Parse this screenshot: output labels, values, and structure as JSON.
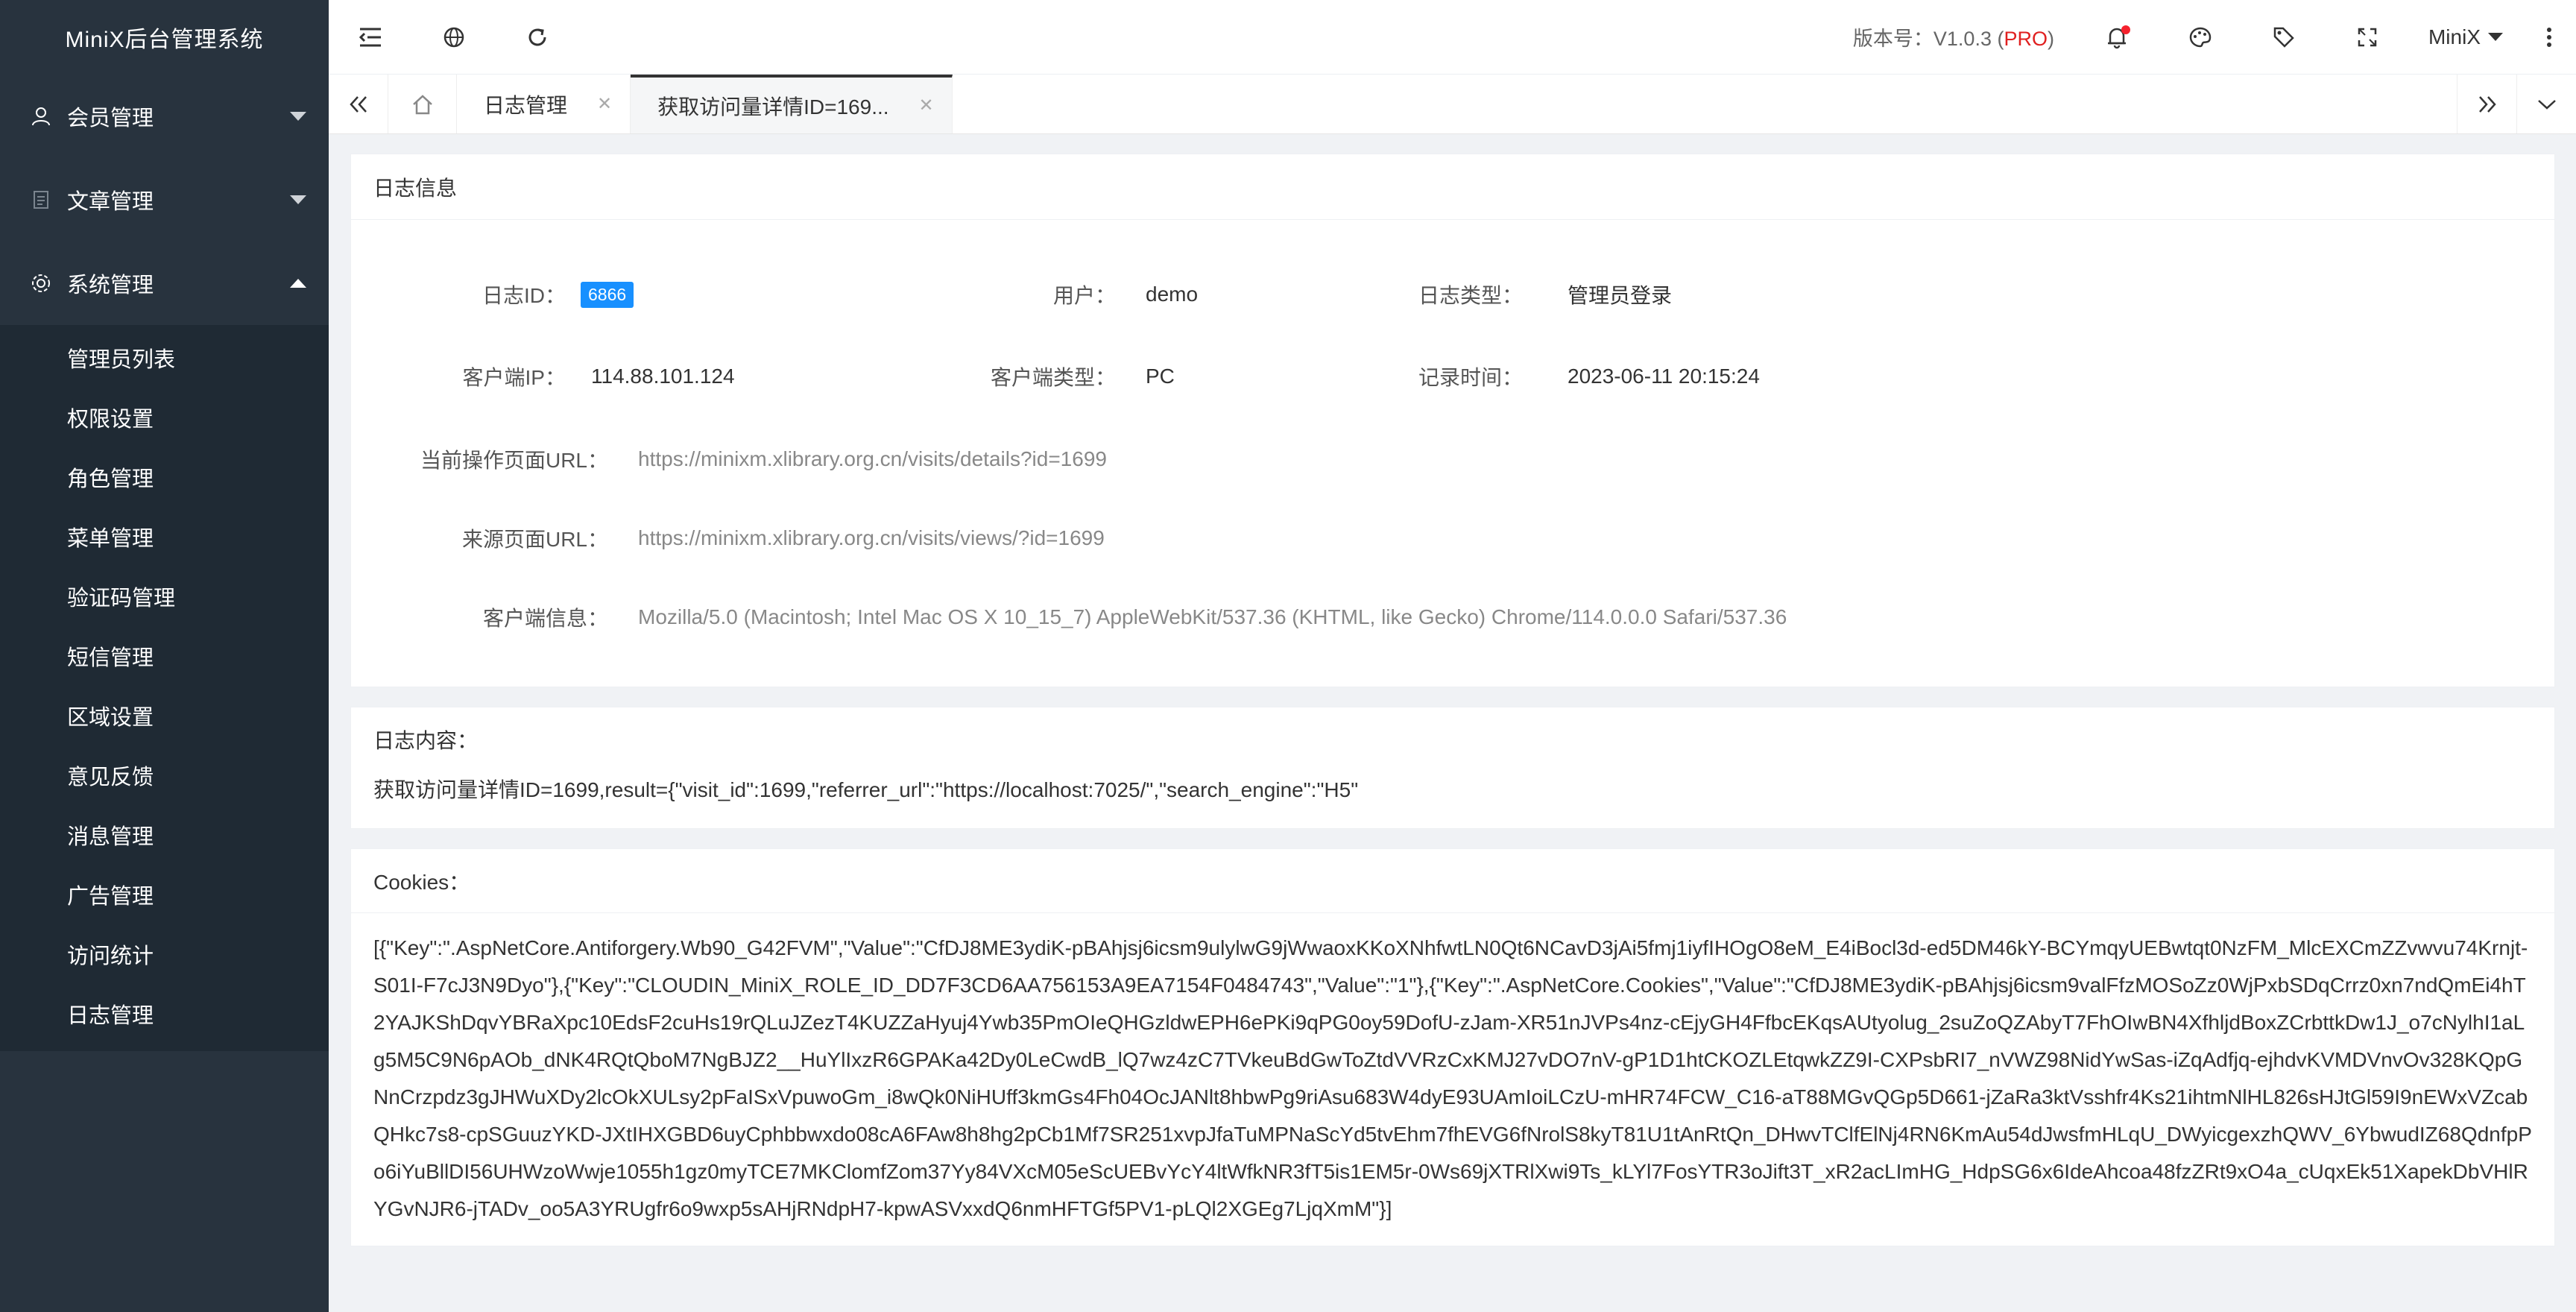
{
  "brand": "MiniX后台管理系统",
  "sidebar": {
    "groups": [
      {
        "label": "会员管理",
        "icon": "user-icon",
        "expanded": false
      },
      {
        "label": "文章管理",
        "icon": "document-icon",
        "expanded": false
      },
      {
        "label": "系统管理",
        "icon": "gear-icon",
        "expanded": true
      }
    ],
    "items": [
      "管理员列表",
      "权限设置",
      "角色管理",
      "菜单管理",
      "验证码管理",
      "短信管理",
      "区域设置",
      "意见反馈",
      "消息管理",
      "广告管理",
      "访问统计",
      "日志管理"
    ]
  },
  "header": {
    "version_label": "版本号：V1.0.3 (",
    "version_pro": "PRO",
    "version_suffix": ")",
    "user": "MiniX"
  },
  "tabs": [
    {
      "label": "日志管理",
      "active": false
    },
    {
      "label": "获取访问量详情ID=169...",
      "active": true
    }
  ],
  "log_info": {
    "title": "日志信息",
    "id_label": "日志ID：",
    "id_value": "6866",
    "user_label": "用户：",
    "user_value": "demo",
    "type_label": "日志类型：",
    "type_value": "管理员登录",
    "ip_label": "客户端IP：",
    "ip_value": "114.88.101.124",
    "client_type_label": "客户端类型：",
    "client_type_value": "PC",
    "time_label": "记录时间：",
    "time_value": "2023-06-11 20:15:24",
    "page_url_label": "当前操作页面URL：",
    "page_url_value": "https://minixm.xlibrary.org.cn/visits/details?id=1699",
    "referrer_label": "来源页面URL：",
    "referrer_value": "https://minixm.xlibrary.org.cn/visits/views/?id=1699",
    "ua_label": "客户端信息：",
    "ua_value": "Mozilla/5.0 (Macintosh; Intel Mac OS X 10_15_7) AppleWebKit/537.36 (KHTML, like Gecko) Chrome/114.0.0.0 Safari/537.36"
  },
  "log_content": {
    "title": "日志内容：",
    "text": "获取访问量详情ID=1699,result={\"visit_id\":1699,\"referrer_url\":\"https://localhost:7025/\",\"search_engine\":\"H5\""
  },
  "cookies": {
    "title": "Cookies：",
    "text": "[{\"Key\":\".AspNetCore.Antiforgery.Wb90_G42FVM\",\"Value\":\"CfDJ8ME3ydiK-pBAhjsj6icsm9ulylwG9jWwaoxKKoXNhfwtLN0Qt6NCavD3jAi5fmj1iyfIHOgO8eM_E4iBocl3d-ed5DM46kY-BCYmqyUEBwtqt0NzFM_MlcEXCmZZvwvu74Krnjt-S01I-F7cJ3N9Dyo\"},{\"Key\":\"CLOUDIN_MiniX_ROLE_ID_DD7F3CD6AA756153A9EA7154F0484743\",\"Value\":\"1\"},{\"Key\":\".AspNetCore.Cookies\",\"Value\":\"CfDJ8ME3ydiK-pBAhjsj6icsm9valFfzMOSoZz0WjPxbSDqCrrz0xn7ndQmEi4hT2YAJKShDqvYBRaXpc10EdsF2cuHs19rQLuJZezT4KUZZaHyuj4Ywb35PmOIeQHGzldwEPH6ePKi9qPG0oy59DofU-zJam-XR51nJVPs4nz-cEjyGH4FfbcEKqsAUtyolug_2suZoQZAbyT7FhOIwBN4XfhljdBoxZCrbttkDw1J_o7cNylhI1aLg5M5C9N6pAOb_dNK4RQtQboM7NgBJZ2__HuYlIxzR6GPAKa42Dy0LeCwdB_lQ7wz4zC7TVkeuBdGwToZtdVVRzCxKMJ27vDO7nV-gP1D1htCKOZLEtqwkZZ9I-CXPsbRI7_nVWZ98NidYwSas-iZqAdfjq-ejhdvKVMDVnvOv328KQpGNnCrzpdz3gJHWuXDy2lcOkXULsy2pFaISxVpuwoGm_i8wQk0NiHUff3kmGs4Fh04OcJANlt8hbwPg9riAsu683W4dyE93UAmIoiLCzU-mHR74FCW_C16-aT88MGvQGp5D661-jZaRa3ktVsshfr4Ks21ihtmNlHL826sHJtGl59I9nEWxVZcabQHkc7s8-cpSGuuzYKD-JXtIHXGBD6uyCphbbwxdo08cA6FAw8h8hg2pCb1Mf7SR251xvpJfaTuMPNaScYd5tvEhm7fhEVG6fNrolS8kyT81U1tAnRtQn_DHwvTClfElNj4RN6KmAu54dJwsfmHLqU_DWyicgexzhQWV_6YbwudIZ68QdnfpPo6iYuBllDI56UHWzoWwje1055h1gz0myTCE7MKClomfZom37Yy84VXcM05eScUEBvYcY4ltWfkNR3fT5is1EM5r-0Ws69jXTRlXwi9Ts_kLYl7FosYTR3oJift3T_xR2acLImHG_HdpSG6x6IdeAhcoa48fzZRt9xO4a_cUqxEk51XapekDbVHlRYGvNJR6-jTADv_oo5A3YRUgfr6o9wxp5sAHjRNdpH7-kpwASVxxdQ6nmHFTGf5PV1-pLQl2XGEg7LjqXmM\"}]"
  },
  "colors": {
    "sidebar": "#28333e",
    "submenu": "#1f2a34",
    "badge": "#1890ff",
    "pro": "#e02020",
    "notify_dot": "#f5222d"
  }
}
